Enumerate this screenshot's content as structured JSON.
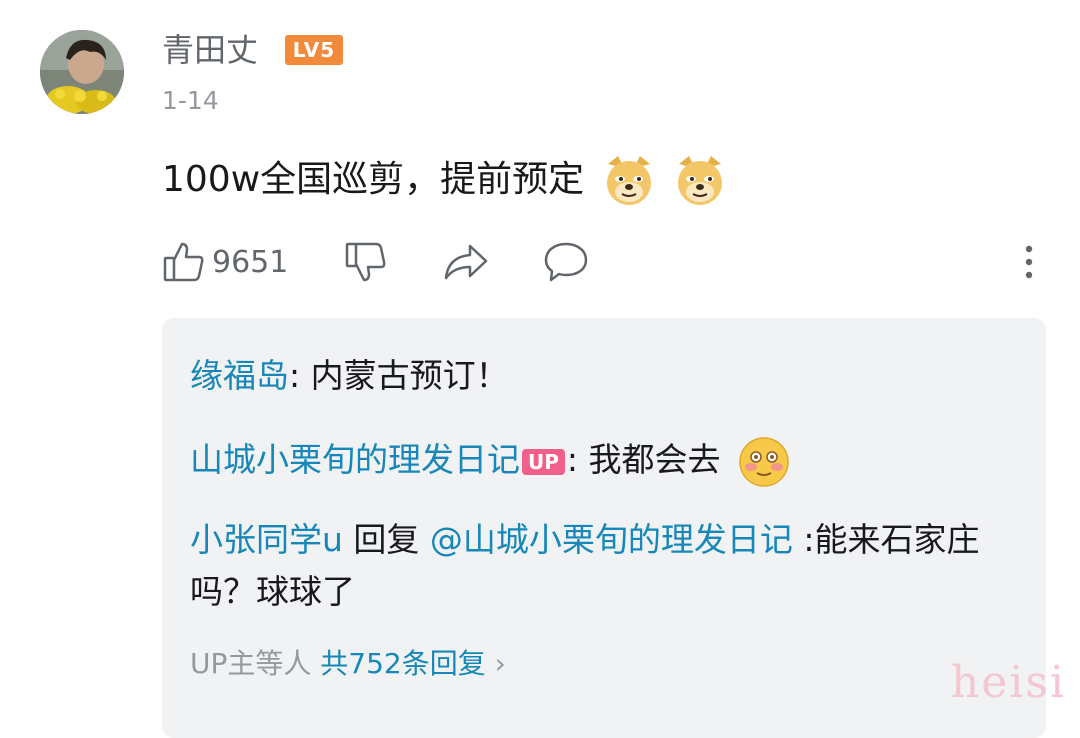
{
  "comment": {
    "username": "青田丈",
    "level": "LV5",
    "date": "1-14",
    "text": "100w全国巡剪，提前预定",
    "emojis": [
      "doge-emoji",
      "doge-emoji"
    ],
    "like_count": "9651"
  },
  "replies": [
    {
      "user": "缘福岛",
      "sep": ":",
      "text": " 内蒙古预订！"
    },
    {
      "user": "山城小栗旬的理发日记",
      "badge": "UP",
      "sep": ":",
      "text": " 我都会去",
      "emoji": "blush-emoji"
    },
    {
      "user": "小张同学u",
      "mid": " 回复 ",
      "mention": "@山城小栗旬的理发日记",
      "text": " :能来石家庄吗？球球了"
    }
  ],
  "more": {
    "prefix": "UP主等人 ",
    "link": "共752条回复",
    "chevron": "›"
  },
  "watermark": "heisi",
  "colors": {
    "link": "#1687b8",
    "level_badge": "#f28a3c",
    "up_badge": "#f0608a",
    "reply_bg": "#f1f2f3"
  }
}
